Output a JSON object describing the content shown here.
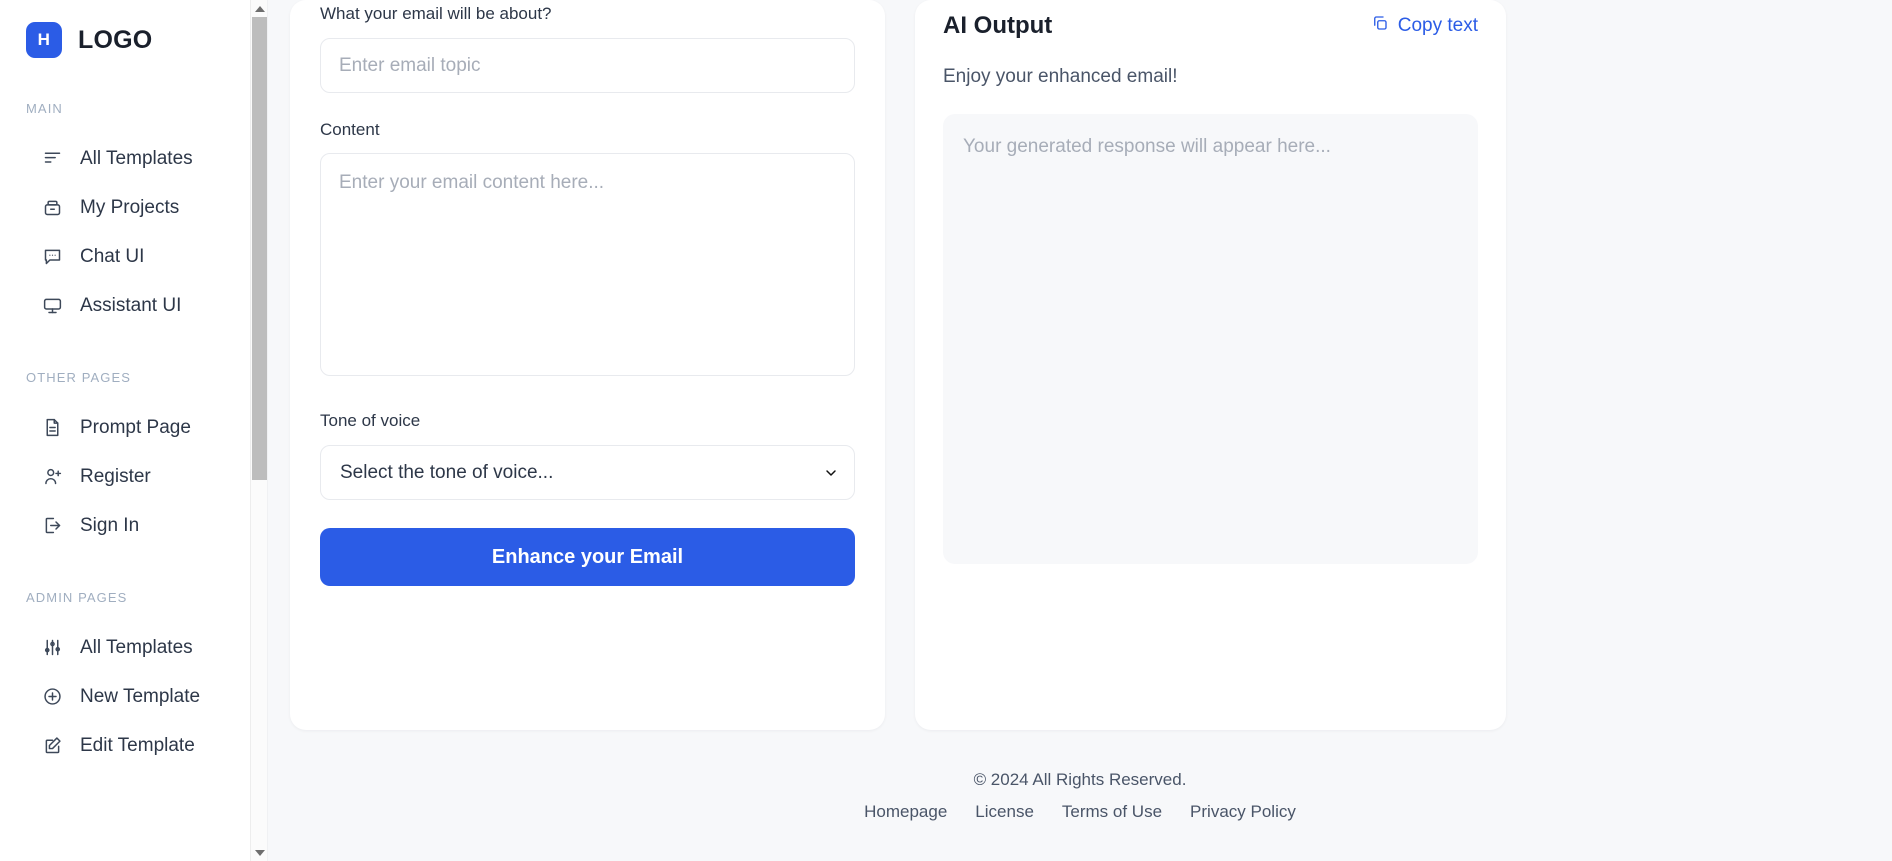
{
  "brand": {
    "mark": "H",
    "name": "LOGO"
  },
  "sidebar": {
    "sections": [
      {
        "title": "MAIN",
        "items": [
          {
            "label": "All Templates",
            "icon": "align-left-icon"
          },
          {
            "label": "My Projects",
            "icon": "archive-icon"
          },
          {
            "label": "Chat UI",
            "icon": "message-square-icon"
          },
          {
            "label": "Assistant UI",
            "icon": "monitor-icon"
          }
        ]
      },
      {
        "title": "OTHER PAGES",
        "items": [
          {
            "label": "Prompt Page",
            "icon": "file-text-icon"
          },
          {
            "label": "Register",
            "icon": "user-plus-icon"
          },
          {
            "label": "Sign In",
            "icon": "log-in-icon"
          }
        ]
      },
      {
        "title": "ADMIN PAGES",
        "items": [
          {
            "label": "All Templates",
            "icon": "sliders-icon"
          },
          {
            "label": "New Template",
            "icon": "plus-circle-icon"
          },
          {
            "label": "Edit Template",
            "icon": "edit-icon"
          }
        ]
      }
    ]
  },
  "form": {
    "topic_label": "What your email will be about?",
    "topic_placeholder": "Enter email topic",
    "topic_value": "",
    "content_label": "Content",
    "content_placeholder": "Enter your email content here...",
    "content_value": "",
    "tone_label": "Tone of voice",
    "tone_selected": "Select the tone of voice...",
    "submit_label": "Enhance your Email"
  },
  "output": {
    "title": "AI Output",
    "copy_label": "Copy text",
    "subtitle": "Enjoy your enhanced email!",
    "placeholder": "Your generated response will appear here..."
  },
  "footer": {
    "copyright": "© 2024 All Rights Reserved.",
    "links": [
      "Homepage",
      "License",
      "Terms of Use",
      "Privacy Policy"
    ]
  },
  "colors": {
    "accent": "#2b5ce6",
    "page_bg": "#f7f8fa",
    "text": "#2d3748"
  }
}
